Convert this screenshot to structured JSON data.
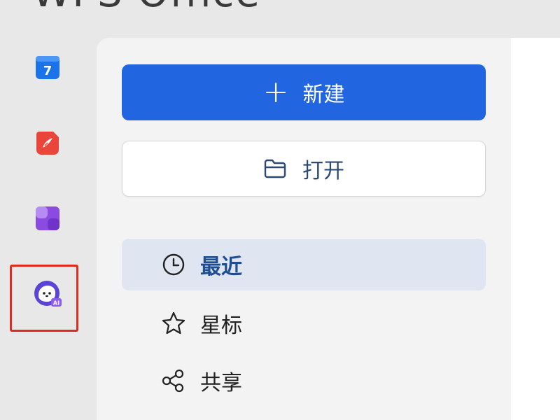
{
  "window": {
    "title": "WPS Office"
  },
  "rail": {
    "items": [
      {
        "name": "calendar-app",
        "label": "7",
        "color": "#1a73e8"
      },
      {
        "name": "pdf-app",
        "color": "#e9453b"
      },
      {
        "name": "docs-app",
        "color": "#8b4be0"
      },
      {
        "name": "ai-assistant",
        "badge": "AI",
        "color": "#5a43d8"
      }
    ]
  },
  "actions": {
    "new_label": "新建",
    "open_label": "打开"
  },
  "nav": {
    "items": [
      {
        "label": "最近",
        "active": true
      },
      {
        "label": "星标",
        "active": false
      },
      {
        "label": "共享",
        "active": false
      }
    ]
  },
  "colors": {
    "primary": "#2265e0",
    "highlight": "#e02a20",
    "active_bg": "#dfe6f2"
  }
}
